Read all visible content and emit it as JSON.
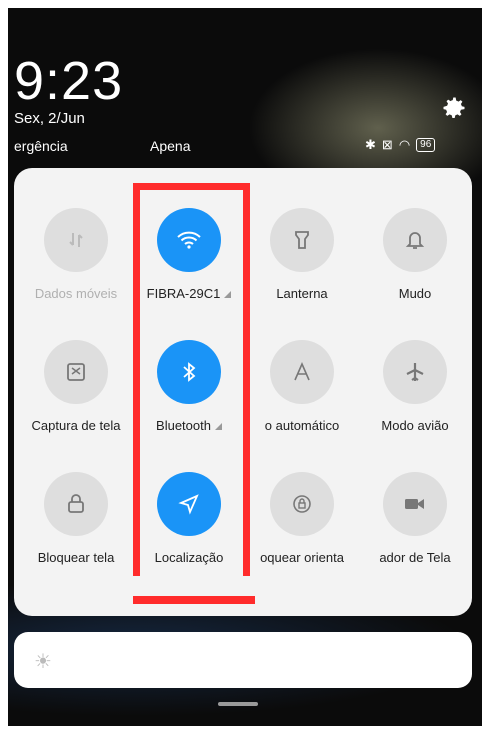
{
  "status": {
    "time": "9:23",
    "date": "Sex, 2/Jun",
    "carrier_left": "ergência",
    "carrier_right": "Apena",
    "battery": "96"
  },
  "tiles": [
    {
      "label": "Dados móveis",
      "icon": "mobile-data-icon",
      "state": "disabled"
    },
    {
      "label": "FIBRA-29C1",
      "icon": "wifi-icon",
      "state": "on"
    },
    {
      "label": "Lanterna",
      "icon": "flashlight-icon",
      "state": "off"
    },
    {
      "label": "Mudo",
      "icon": "bell-icon",
      "state": "off"
    },
    {
      "label": "Captura de tela",
      "icon": "screenshot-icon",
      "state": "off"
    },
    {
      "label": "Bluetooth",
      "icon": "bluetooth-icon",
      "state": "on"
    },
    {
      "label": "o automático",
      "icon": "auto-brightness-icon",
      "state": "off"
    },
    {
      "label": "Modo avião",
      "icon": "airplane-icon",
      "state": "off"
    },
    {
      "label": "Bloquear tela",
      "icon": "lock-icon",
      "state": "off"
    },
    {
      "label": "Localização",
      "icon": "location-icon",
      "state": "on"
    },
    {
      "label": "oquear orienta",
      "icon": "rotation-lock-icon",
      "state": "off"
    },
    {
      "label": "ador de Tela",
      "icon": "screen-recorder-icon",
      "state": "off"
    }
  ],
  "colors": {
    "accent": "#1a94f7",
    "highlight": "#ff2b2b"
  }
}
